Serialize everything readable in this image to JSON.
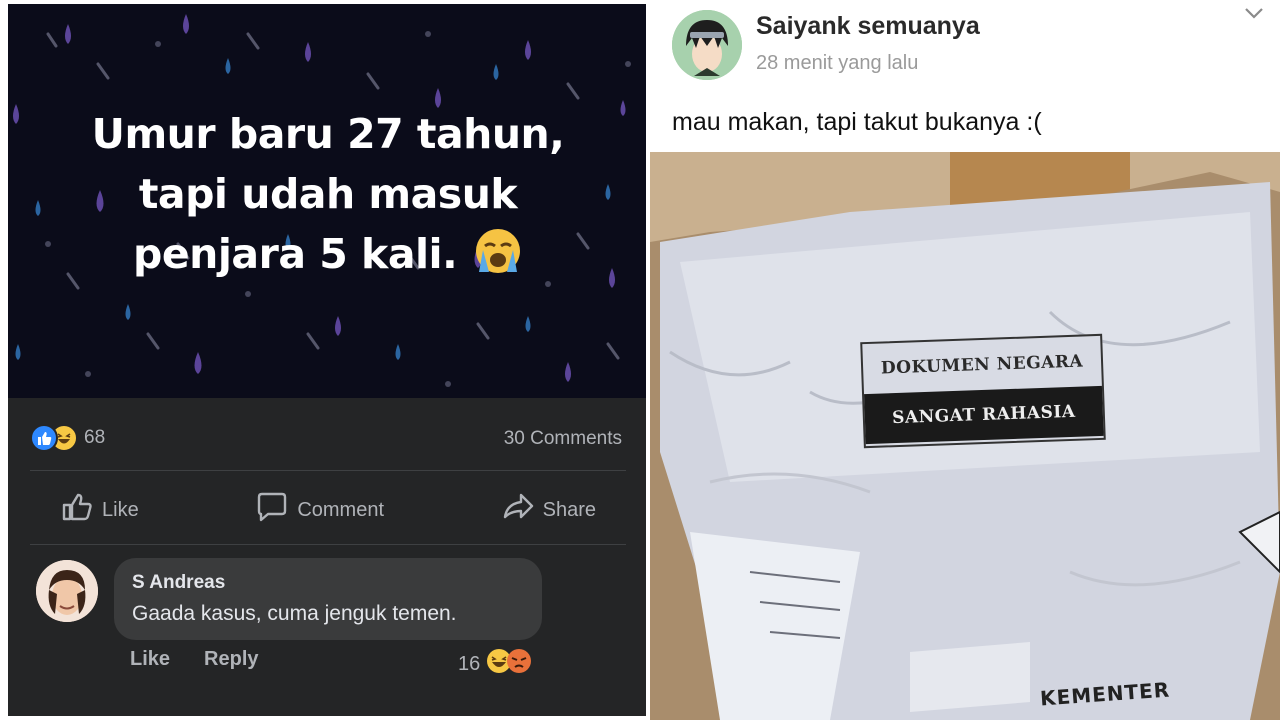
{
  "left_post": {
    "story_text": "Umur baru 27 tahun, tapi udah masuk penjara 5 kali.",
    "story_emoji": "crying-face-emoji",
    "reaction_count": "68",
    "comments_count": "30 Comments",
    "actions": {
      "like": "Like",
      "comment": "Comment",
      "share": "Share"
    },
    "comment": {
      "author": "S Andreas",
      "text": "Gaada kasus, cuma jenguk temen.",
      "like": "Like",
      "reply": "Reply",
      "reaction_count": "16"
    }
  },
  "right_post": {
    "author": "Saiyank semuanya",
    "time": "28 menit yang lalu",
    "text": "mau makan, tapi takut bukanya :(",
    "photo_label_top": "DOKUMEN NEGARA",
    "photo_label_bottom": "SANGAT RAHASIA",
    "photo_stamp": "KEMENTER"
  },
  "colors": {
    "dark_bg": "#242526",
    "story_bg": "#0b0c1a",
    "like_blue": "#2d88ff",
    "text_muted": "#b0b3b8"
  }
}
